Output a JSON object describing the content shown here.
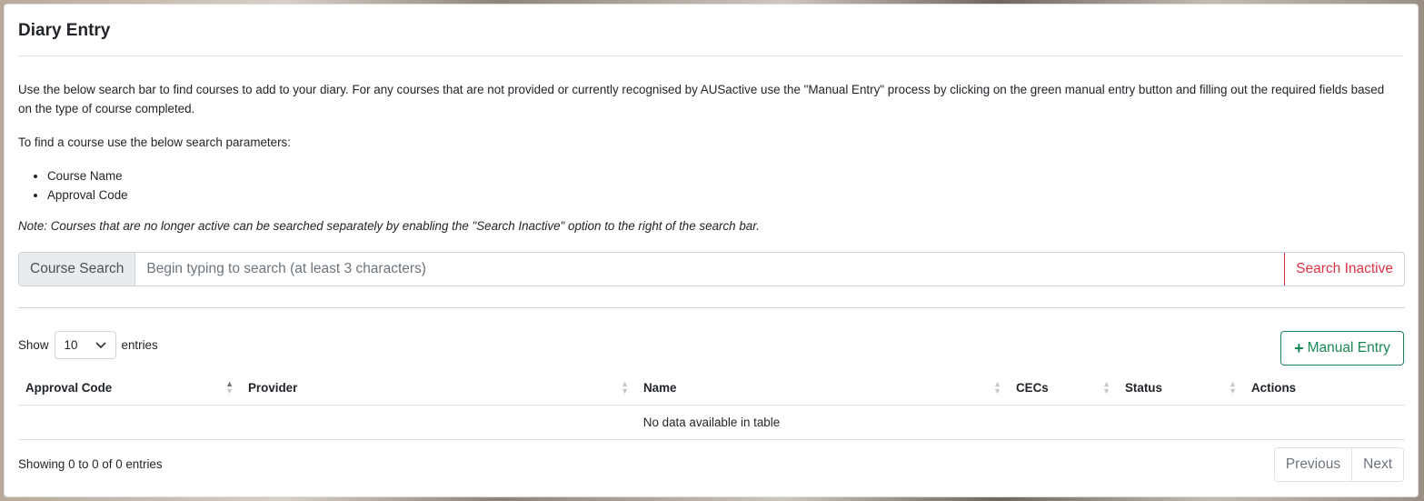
{
  "card": {
    "title": "Diary Entry"
  },
  "intro": {
    "paragraph": "Use the below search bar to find courses to add to your diary. For any courses that are not provided or currently recognised by AUSactive use the \"Manual Entry\" process by clicking on the green manual entry button and filling out the required fields based on the type of course completed.",
    "params_heading": "To find a course use the below search parameters:",
    "params": [
      "Course Name",
      "Approval Code"
    ],
    "note": "Note: Courses that are no longer active can be searched separately by enabling the \"Search Inactive\" option to the right of the search bar."
  },
  "search": {
    "label": "Course Search",
    "placeholder": "Begin typing to search (at least 3 characters)",
    "value": "",
    "inactive_button": "Search Inactive"
  },
  "length_menu": {
    "prefix": "Show",
    "selected": "10",
    "suffix": "entries"
  },
  "manual_entry": {
    "icon": "plus-icon",
    "label": "Manual Entry",
    "color": "#198754"
  },
  "table": {
    "columns": [
      "Approval Code",
      "Provider",
      "Name",
      "CECs",
      "Status",
      "Actions"
    ],
    "empty_message": "No data available in table"
  },
  "footer": {
    "info": "Showing 0 to 0 of 0 entries",
    "previous": "Previous",
    "next": "Next"
  },
  "colors": {
    "danger": "#dc3545",
    "success": "#198754"
  }
}
